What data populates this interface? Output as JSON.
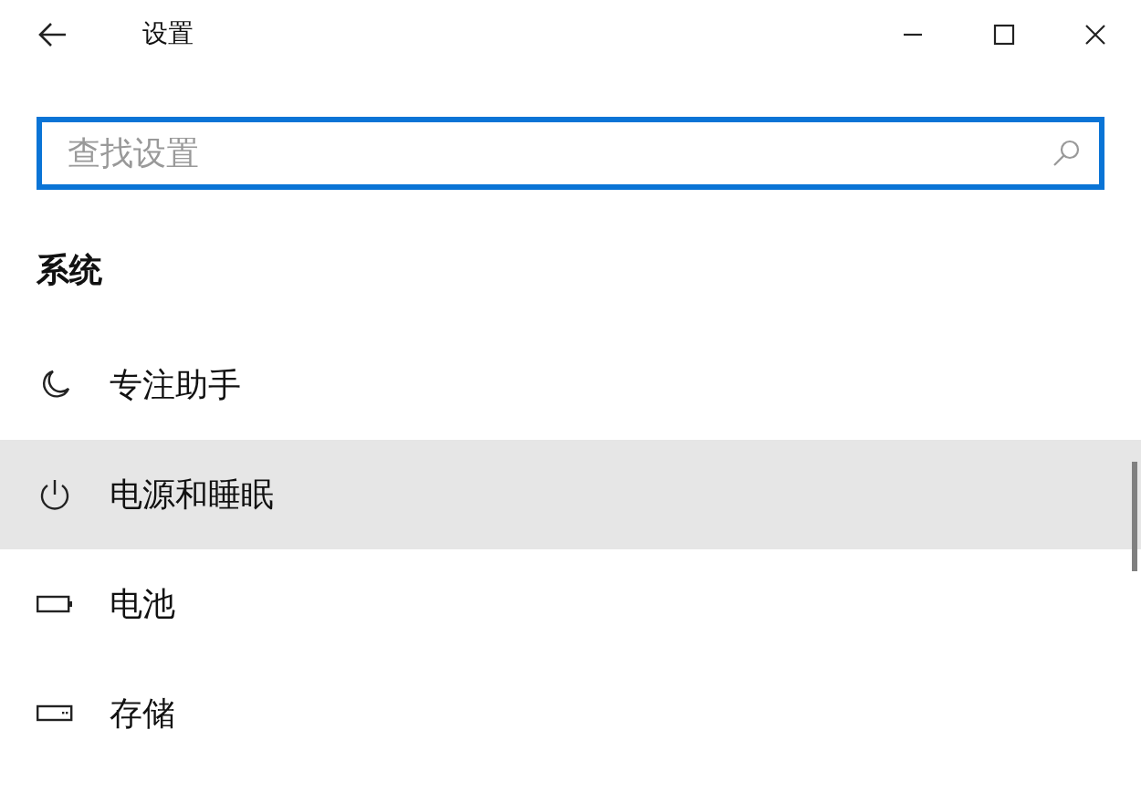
{
  "window": {
    "title": "设置"
  },
  "search": {
    "placeholder": "查找设置"
  },
  "section": {
    "title": "系统"
  },
  "items": [
    {
      "label": "专注助手",
      "selected": false
    },
    {
      "label": "电源和睡眠",
      "selected": true
    },
    {
      "label": "电池",
      "selected": false
    },
    {
      "label": "存储",
      "selected": false
    }
  ]
}
